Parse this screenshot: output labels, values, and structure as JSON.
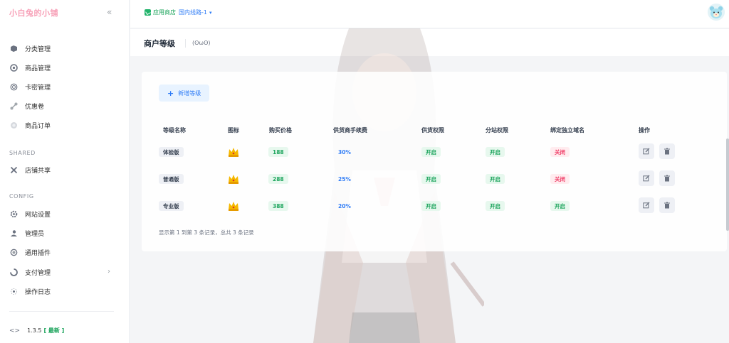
{
  "app": {
    "brand": "小白兔的小铺",
    "collapse_icon": "double-chevron-left-icon"
  },
  "sidebar": {
    "items_top": [
      {
        "label": "分类管理",
        "icon": "category-icon"
      },
      {
        "label": "商品管理",
        "icon": "goods-icon"
      },
      {
        "label": "卡密管理",
        "icon": "card-key-icon"
      },
      {
        "label": "优惠卷",
        "icon": "coupon-icon"
      },
      {
        "label": "商品订单",
        "icon": "order-icon"
      }
    ],
    "section_shared": "SHARED",
    "items_shared": [
      {
        "label": "店铺共享",
        "icon": "share-icon"
      }
    ],
    "section_config": "CONFIG",
    "items_config": [
      {
        "label": "网站设置",
        "icon": "settings-icon"
      },
      {
        "label": "管理员",
        "icon": "admin-icon"
      },
      {
        "label": "通用插件",
        "icon": "plugin-icon"
      },
      {
        "label": "支付管理",
        "icon": "payment-icon"
      },
      {
        "label": "操作日志",
        "icon": "log-icon"
      }
    ],
    "version": "1.3.5",
    "version_tag": "[ 最新 ]"
  },
  "topbar": {
    "store_label": "应用商店",
    "route_label": "国内线路-1"
  },
  "page": {
    "title": "商户等级",
    "emote": "(ʘωʘ)"
  },
  "content": {
    "add_button": "新增等级",
    "columns": [
      "等级名称",
      "图标",
      "购买价格",
      "供货商手续费",
      "供货权限",
      "分站权限",
      "绑定独立域名",
      "操作"
    ],
    "rows": [
      {
        "name": "体验版",
        "price": "188",
        "fee": "30%",
        "supply": "开启",
        "substation": "开启",
        "domain": "关闭"
      },
      {
        "name": "普通版",
        "price": "288",
        "fee": "25%",
        "supply": "开启",
        "substation": "开启",
        "domain": "关闭"
      },
      {
        "name": "专业版",
        "price": "388",
        "fee": "20%",
        "supply": "开启",
        "substation": "开启",
        "domain": "开启"
      }
    ],
    "footer": "显示第 1 到第 3 条记录，总共 3 条记录"
  },
  "colors": {
    "brand": "#f7a1b8",
    "accent_blue": "#2f7cf6",
    "green": "#19a35a",
    "red": "#f0426b"
  }
}
